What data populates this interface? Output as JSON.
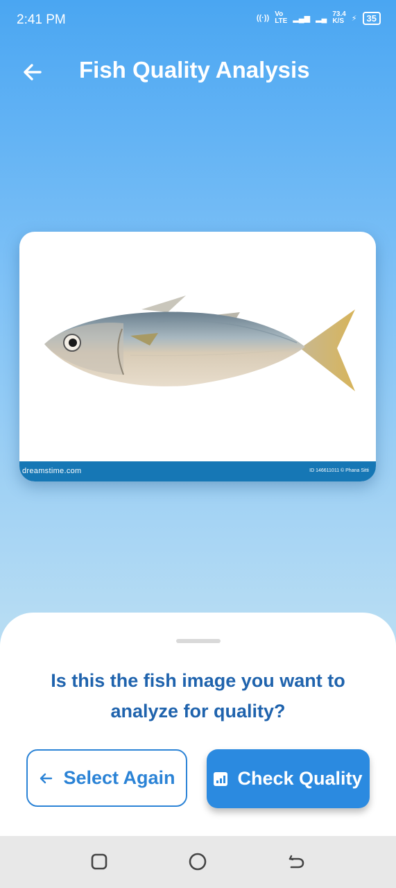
{
  "status_bar": {
    "time": "2:41 PM",
    "net_speed_value": "73.4",
    "net_speed_unit": "K/S",
    "battery": "35",
    "volte": "Vo",
    "lte": "LTE"
  },
  "header": {
    "title": "Fish Quality Analysis"
  },
  "image": {
    "watermark_site": "dreamstime.com",
    "watermark_id": "ID 146611011 © Phana Sitti"
  },
  "sheet": {
    "question": "Is this the fish image you want to analyze for quality?",
    "select_again_label": "Select Again",
    "check_quality_label": "Check Quality"
  },
  "colors": {
    "accent": "#2b8ae0",
    "text_primary": "#1f63ad"
  }
}
